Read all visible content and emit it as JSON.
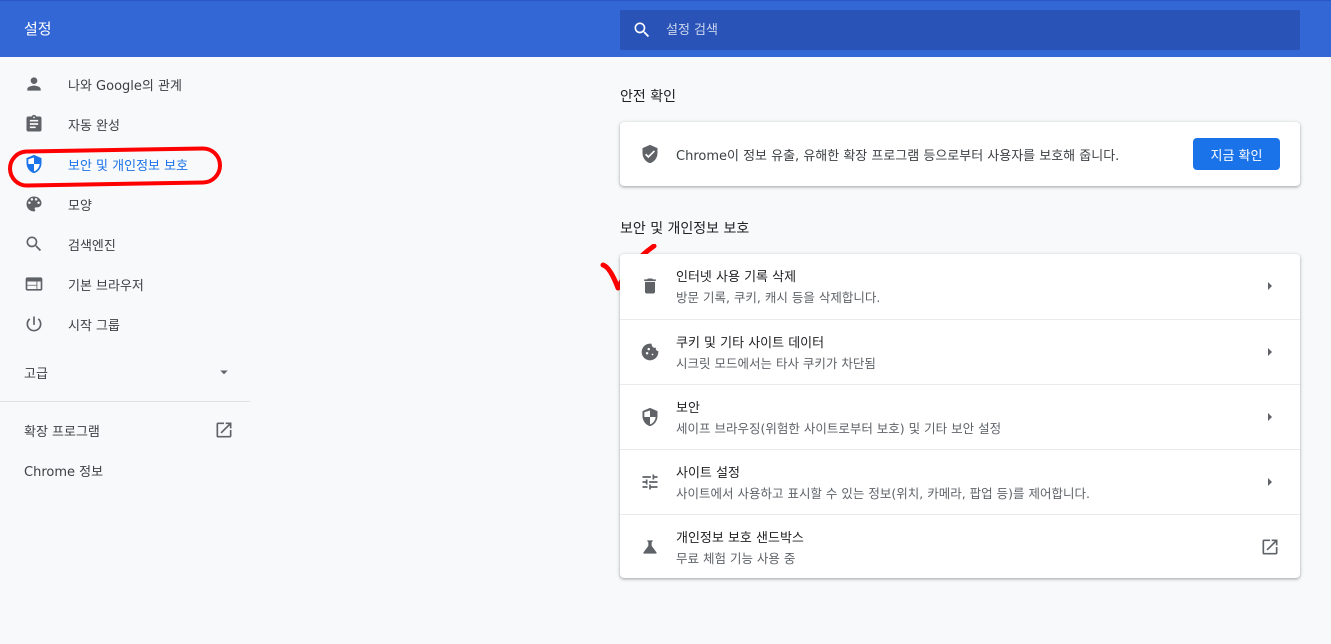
{
  "header": {
    "title": "설정",
    "search_placeholder": "설정 검색",
    "search_value": ""
  },
  "sidebar": {
    "items": [
      {
        "label": "나와 Google의 관계",
        "icon": "person-icon"
      },
      {
        "label": "자동 완성",
        "icon": "clipboard-icon"
      },
      {
        "label": "보안 및 개인정보 보호",
        "icon": "shield-icon",
        "active": true
      },
      {
        "label": "모양",
        "icon": "palette-icon"
      },
      {
        "label": "검색엔진",
        "icon": "search-icon"
      },
      {
        "label": "기본 브라우저",
        "icon": "browser-window-icon"
      },
      {
        "label": "시작 그룹",
        "icon": "power-icon"
      }
    ],
    "advanced_label": "고급",
    "extensions_label": "확장 프로그램",
    "about_label": "Chrome 정보"
  },
  "safety_check": {
    "section_title": "안전 확인",
    "description": "Chrome이 정보 유출, 유해한 확장 프로그램 등으로부터 사용자를 보호해 줍니다.",
    "button_label": "지금 확인"
  },
  "privacy": {
    "section_title": "보안 및 개인정보 보호",
    "rows": [
      {
        "title": "인터넷 사용 기록 삭제",
        "subtitle": "방문 기록, 쿠키, 캐시 등을 삭제합니다.",
        "icon": "trash-icon",
        "action": "arrow"
      },
      {
        "title": "쿠키 및 기타 사이트 데이터",
        "subtitle": "시크릿 모드에서는 타사 쿠키가 차단됨",
        "icon": "cookie-icon",
        "action": "arrow"
      },
      {
        "title": "보안",
        "subtitle": "세이프 브라우징(위험한 사이트로부터 보호) 및 기타 보안 설정",
        "icon": "shield-icon",
        "action": "arrow"
      },
      {
        "title": "사이트 설정",
        "subtitle": "사이트에서 사용하고 표시할 수 있는 정보(위치, 카메라, 팝업 등)를 제어합니다.",
        "icon": "tune-icon",
        "action": "arrow"
      },
      {
        "title": "개인정보 보호 샌드박스",
        "subtitle": "무료 체험 기능 사용 중",
        "icon": "flask-icon",
        "action": "external"
      }
    ]
  },
  "colors": {
    "header_blue": "#3367d6",
    "accent_blue": "#1a73e8",
    "annotation_red": "#ff0000"
  }
}
